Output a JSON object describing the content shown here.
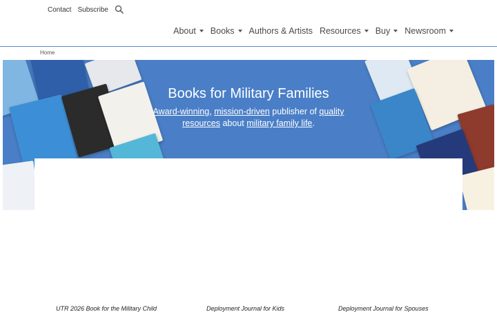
{
  "utility_nav": {
    "contact": "Contact",
    "subscribe": "Subscribe"
  },
  "main_nav": [
    {
      "label": "About"
    },
    {
      "label": "Books"
    },
    {
      "label": "Authors & Artists"
    },
    {
      "label": "Resources"
    },
    {
      "label": "Buy"
    },
    {
      "label": "Newsroom"
    }
  ],
  "breadcrumb": "Home",
  "hero": {
    "title": "Books for Military Families",
    "award": "Award-winning",
    "comma": ",",
    "mission": "mission-driven",
    "publisher_of": " publisher of ",
    "quality": "quality resources",
    "about": " about ",
    "military_life": "military family life",
    "period": "."
  },
  "product_captions": [
    "UTR 2026 Book for the Military Child",
    "Deployment Journal for Kids",
    "Deployment Journal for Spouses"
  ],
  "colors": {
    "hero_bg": "#4a7fc7",
    "nav_rule": "#5b86c4"
  }
}
